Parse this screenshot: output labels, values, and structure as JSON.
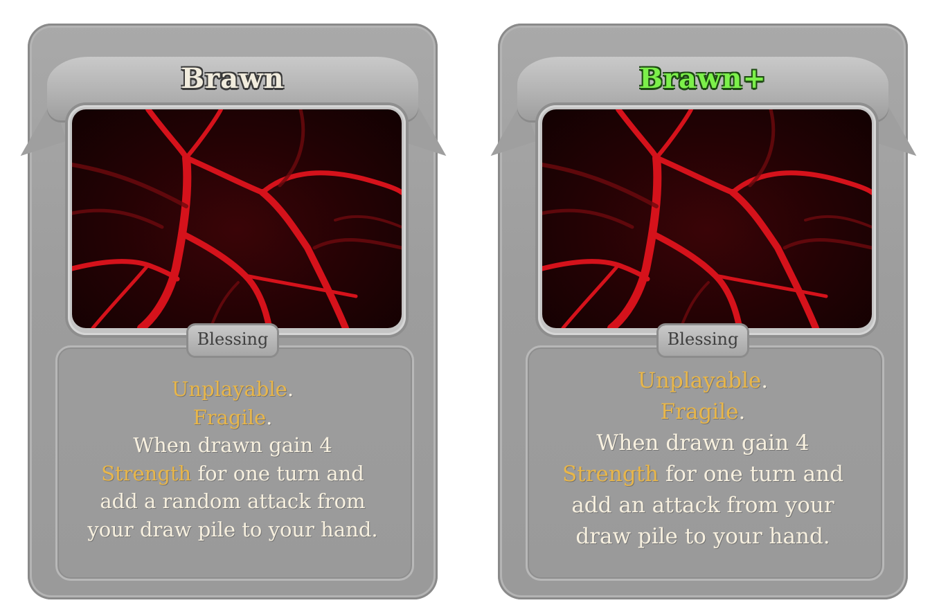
{
  "colors": {
    "card_gray": "#9d9d9d",
    "title_normal": "#f1ecdd",
    "title_upgraded": "#7cf04a",
    "keyword": "#e8b64a",
    "description": "#f7f0df",
    "vein_red": "#d5121b"
  },
  "cards": [
    {
      "title": "Brawn",
      "type": "Blessing",
      "art_icon": "red-veins-art",
      "description": {
        "line1_keyword": "Unplayable",
        "line1_rest": ".",
        "line2_keyword": "Fragile",
        "line2_rest": ".",
        "line3": "When drawn gain 4",
        "line4_keyword": "Strength",
        "line4_rest": " for one turn and",
        "line5": "add a random attack from",
        "line6": "your draw pile to your hand."
      }
    },
    {
      "title": "Brawn+",
      "type": "Blessing",
      "art_icon": "red-veins-art",
      "description": {
        "line1_keyword": "Unplayable",
        "line1_rest": ".",
        "line2_keyword": "Fragile",
        "line2_rest": ".",
        "line3": "When drawn gain 4",
        "line4_keyword": "Strength",
        "line4_rest": " for one turn and",
        "line5": "add an attack from your",
        "line6": "draw pile to your hand."
      }
    }
  ]
}
